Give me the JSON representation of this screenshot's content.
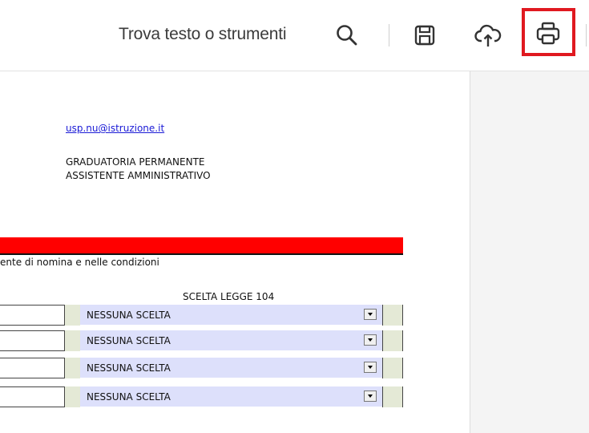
{
  "toolbar": {
    "find_label": "Trova testo o strumenti",
    "icons": [
      "search-icon",
      "save-icon",
      "upload-cloud-icon",
      "print-icon"
    ],
    "highlight_color": "#e01920"
  },
  "document": {
    "email": "usp.nu@istruzione.it",
    "heading_line1": "GRADUATORIA PERMANENTE",
    "heading_line2": "ASSISTENTE AMMINISTRATIVO",
    "banner_color": "#ff0000",
    "condition_text": "ente di nomina e nelle condizioni",
    "table_header": "SCELTA LEGGE 104",
    "rows": [
      {
        "choice": "NESSUNA SCELTA"
      },
      {
        "choice": "NESSUNA SCELTA"
      },
      {
        "choice": "NESSUNA SCELTA"
      },
      {
        "choice": "NESSUNA SCELTA"
      }
    ]
  }
}
